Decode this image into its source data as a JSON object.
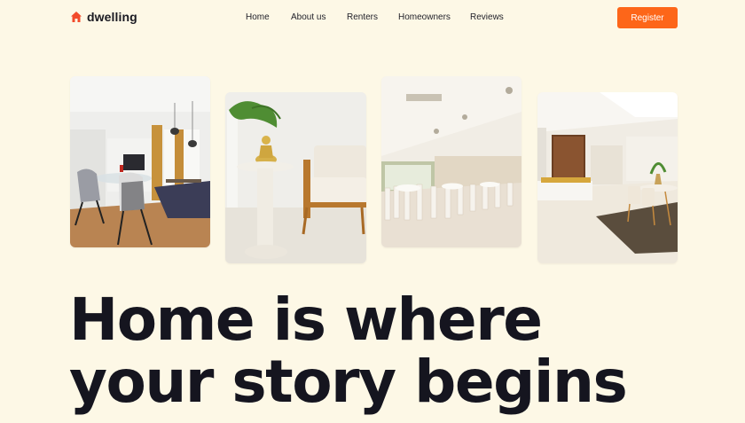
{
  "brand": {
    "name": "dwelling",
    "logo_icon": "house-icon",
    "accent_color": "#f24b2b"
  },
  "nav": {
    "items": [
      {
        "label": "Home"
      },
      {
        "label": "About us"
      },
      {
        "label": "Renters"
      },
      {
        "label": "Homeowners"
      },
      {
        "label": "Reviews"
      }
    ]
  },
  "header": {
    "register_label": "Register",
    "register_color": "#fd6619"
  },
  "gallery": {
    "photos": [
      {
        "subject": "dining-room-photo"
      },
      {
        "subject": "armchair-side-table-photo"
      },
      {
        "subject": "event-hall-photo"
      },
      {
        "subject": "open-living-room-photo"
      }
    ]
  },
  "hero": {
    "line1": "Home is where",
    "line2": "your story begins"
  },
  "colors": {
    "background": "#fdf8e6",
    "text": "#15151f"
  }
}
